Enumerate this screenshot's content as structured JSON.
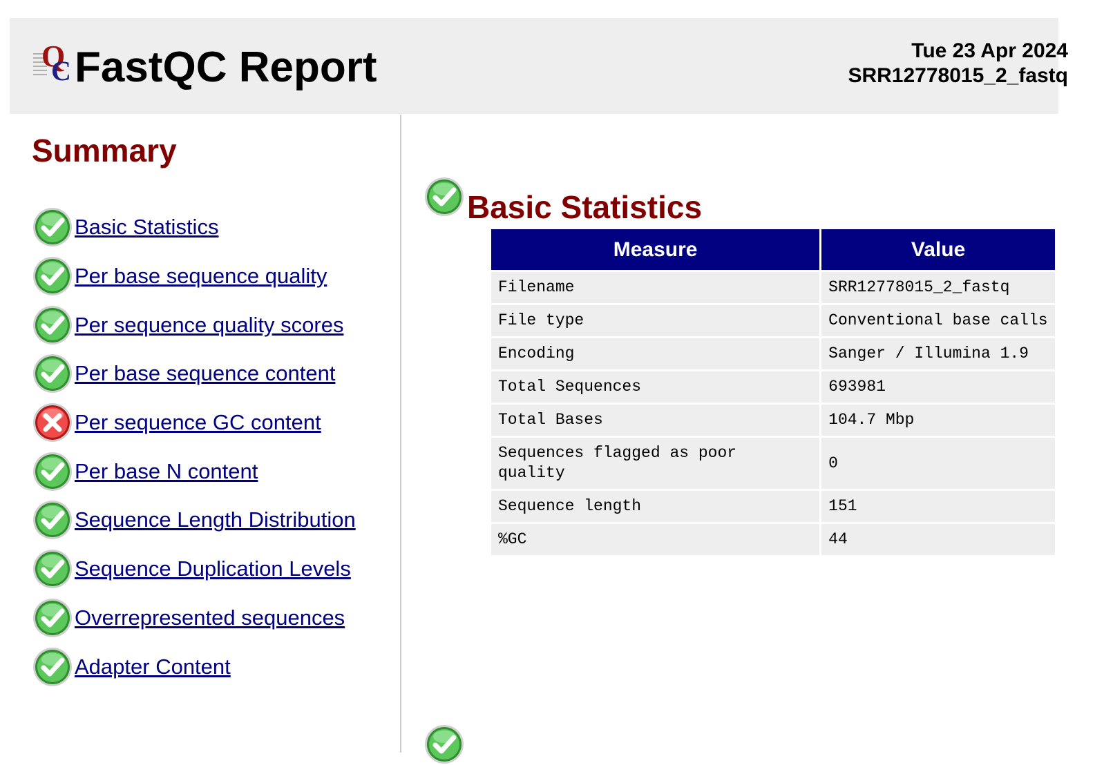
{
  "header": {
    "title": "FastQC Report",
    "date": "Tue 23 Apr 2024",
    "filename": "SRR12778015_2_fastq"
  },
  "summary": {
    "title": "Summary",
    "items": [
      {
        "label": "Basic Statistics",
        "status": "pass"
      },
      {
        "label": "Per base sequence quality",
        "status": "pass"
      },
      {
        "label": "Per sequence quality scores",
        "status": "pass"
      },
      {
        "label": "Per base sequence content",
        "status": "pass"
      },
      {
        "label": "Per sequence GC content",
        "status": "fail"
      },
      {
        "label": "Per base N content",
        "status": "pass"
      },
      {
        "label": "Sequence Length Distribution",
        "status": "pass"
      },
      {
        "label": "Sequence Duplication Levels",
        "status": "pass"
      },
      {
        "label": "Overrepresented sequences",
        "status": "pass"
      },
      {
        "label": "Adapter Content",
        "status": "pass"
      }
    ]
  },
  "module": {
    "title": "Basic Statistics",
    "status": "pass",
    "table": {
      "headers": [
        "Measure",
        "Value"
      ],
      "rows": [
        [
          "Filename",
          "SRR12778015_2_fastq"
        ],
        [
          "File type",
          "Conventional base calls"
        ],
        [
          "Encoding",
          "Sanger / Illumina 1.9"
        ],
        [
          "Total Sequences",
          "693981"
        ],
        [
          "Total Bases",
          "104.7 Mbp"
        ],
        [
          "Sequences flagged as poor quality",
          "0"
        ],
        [
          "Sequence length",
          "151"
        ],
        [
          "%GC",
          "44"
        ]
      ]
    }
  },
  "colors": {
    "accent": "#800000",
    "link": "#000080",
    "table_header": "#000080",
    "header_bg": "#eeeeee",
    "pass": "#3aa83a",
    "fail": "#e02020"
  },
  "icons": {
    "pass": "pass-check-icon",
    "fail": "fail-cross-icon"
  }
}
